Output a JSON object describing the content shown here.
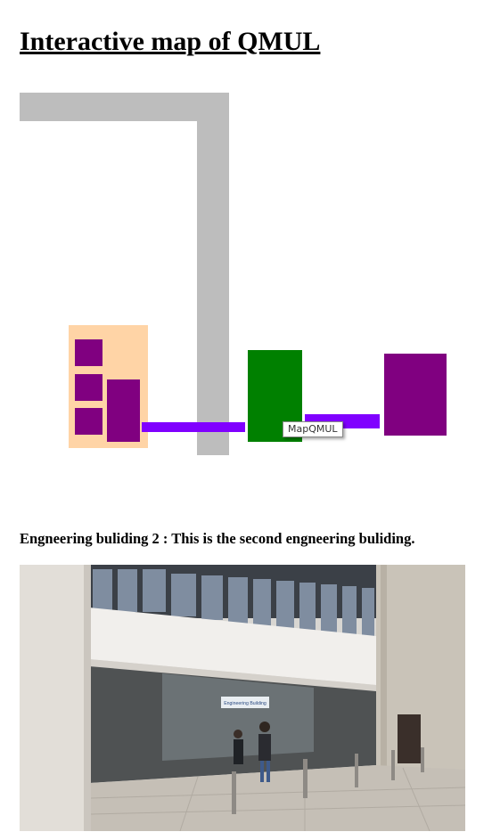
{
  "page": {
    "title": "Interactive map of QMUL"
  },
  "map": {
    "image_map_title": "MapQMUL",
    "colors": {
      "road": "#bdbdbd",
      "building_base": "#ffd4a6",
      "room": "#800080",
      "walkway": "#8000ff",
      "engineering_building_2": "#008000"
    }
  },
  "info": {
    "description": "Engneering buliding 2 : This is the second engneering buliding."
  },
  "photo": {
    "sign_text": "Engineering Building"
  }
}
